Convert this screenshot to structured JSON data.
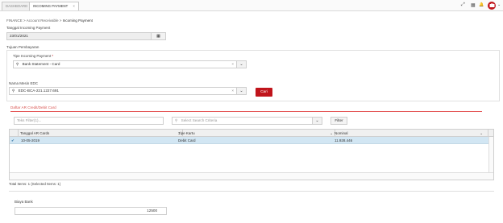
{
  "tabs": [
    {
      "label": "DASHBOARD"
    },
    {
      "label": "INCOMING PAYMENT",
      "close": "×"
    }
  ],
  "top_icons": {
    "expand": "⤢",
    "grid": "▦",
    "bell": "🔔",
    "chevron": "⌄"
  },
  "breadcrumb": {
    "root": "FINANCE",
    "sep": ">",
    "mid": "Account Receivable",
    "current": "Incoming Payment"
  },
  "form": {
    "tanggal_label": "Tanggal Incoming Payment",
    "tanggal_value": "23/01/2021",
    "tujuan_label": "Tujuan Pembayaran",
    "tipe_label": "Tipe Incoming Payment",
    "required_mark": "*",
    "tipe_value": "Bank Statement - Card",
    "mesin_label": "Nama Mesin EDC",
    "mesin_value": "EDC-BCA-221.1227.691",
    "cari_button": "Cari",
    "clear_mark": "×",
    "search_glyph": "⚲",
    "dropdown_glyph": "⌄",
    "calendar_glyph": "▦"
  },
  "section": {
    "title": "Daftar AR Credit/Debit Card"
  },
  "filter": {
    "text_placeholder": "Teks Filter(1)...",
    "criteria_placeholder": "Select Search Criteria",
    "button": "Filter"
  },
  "table": {
    "headers": [
      "Tanggal AR Cards",
      "Tipe Kartu",
      "Nominal"
    ],
    "rows": [
      {
        "check": "✔",
        "tanggal": "10-05-2019",
        "tipe": "Debit Card",
        "nominal": "11.928.446"
      }
    ],
    "footer": "Total Items: 1 (Selected Items: 1)"
  },
  "biaya": {
    "label": "Biaya Bank",
    "value": "12500"
  }
}
